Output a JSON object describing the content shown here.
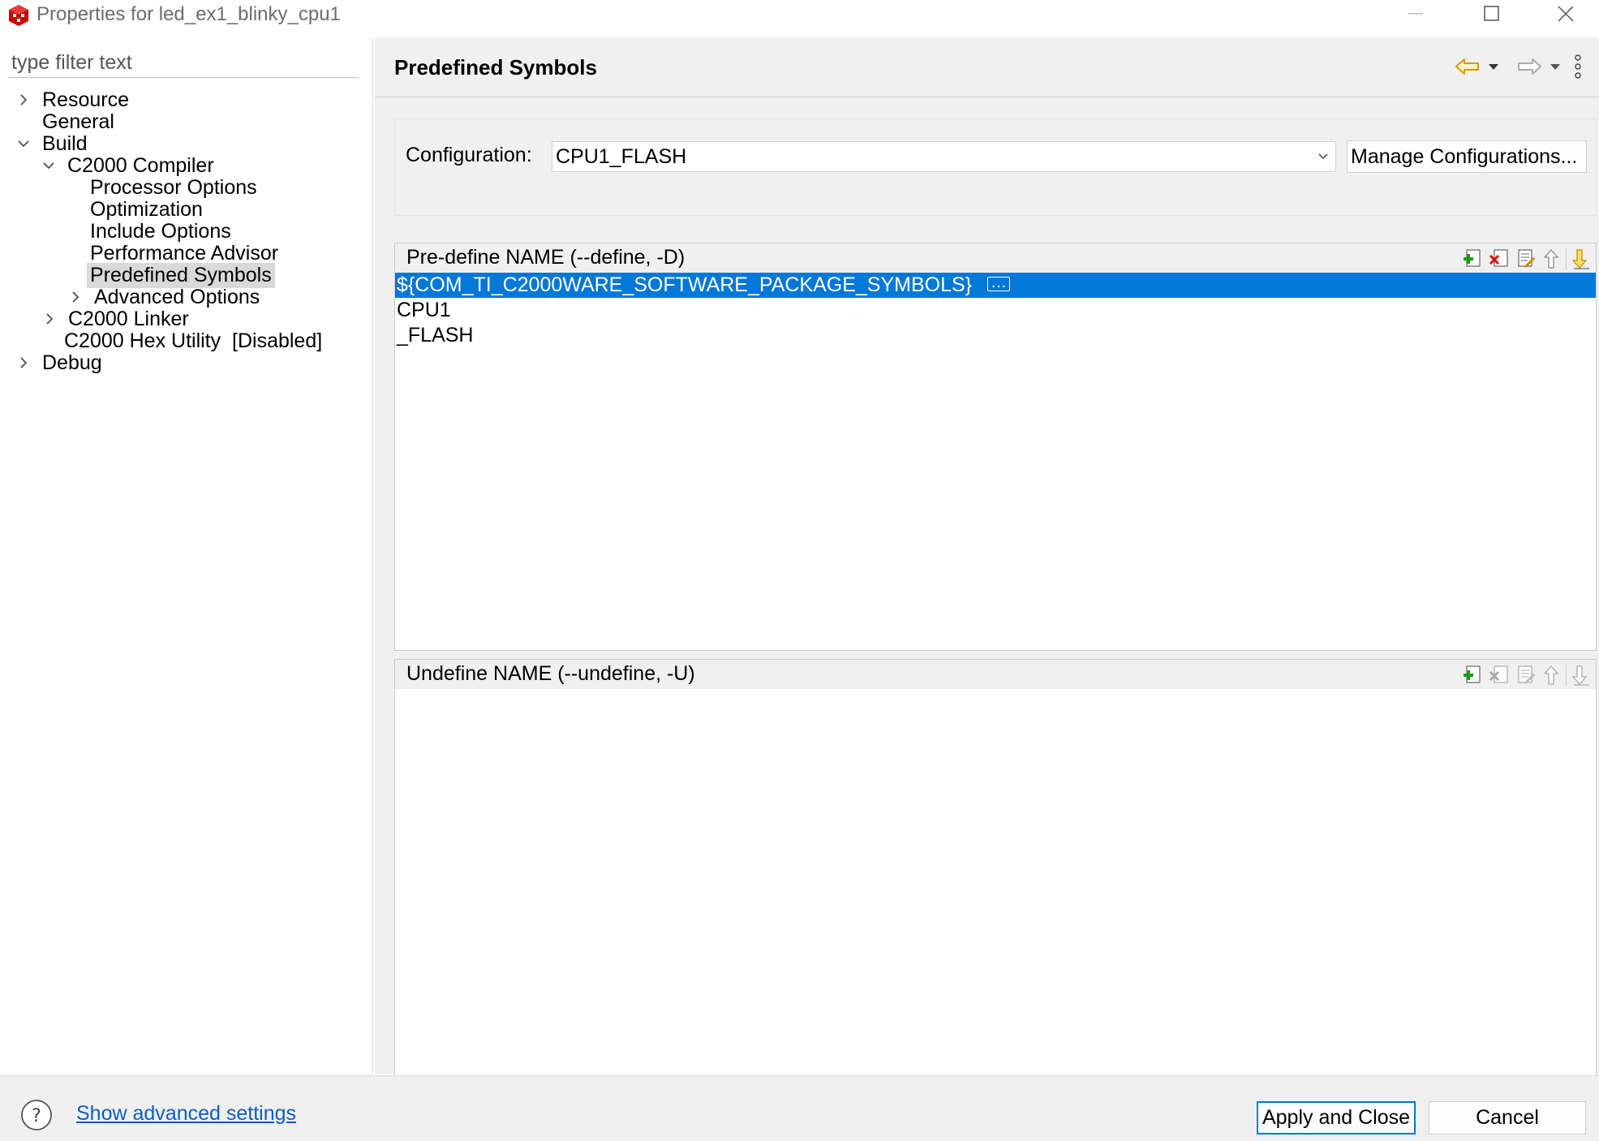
{
  "window": {
    "title": "Properties for led_ex1_blinky_cpu1",
    "app_icon": "ti-cube-icon",
    "controls": [
      "minimize-icon",
      "maximize-icon",
      "close-icon"
    ]
  },
  "sidebar": {
    "filter_placeholder": "type filter text",
    "tree": [
      {
        "label": "Resource",
        "expander": "collapsed"
      },
      {
        "label": "General",
        "expander": "none"
      },
      {
        "label": "Build",
        "expander": "expanded"
      },
      {
        "label": "C2000 Compiler",
        "expander": "expanded"
      },
      {
        "label": "Processor Options",
        "expander": "none"
      },
      {
        "label": "Optimization",
        "expander": "none"
      },
      {
        "label": "Include Options",
        "expander": "none"
      },
      {
        "label": "Performance Advisor",
        "expander": "none"
      },
      {
        "label": "Predefined Symbols",
        "expander": "none",
        "selected": true
      },
      {
        "label": "Advanced Options",
        "expander": "collapsed"
      },
      {
        "label": "C2000 Linker",
        "expander": "collapsed"
      },
      {
        "label": "C2000 Hex Utility  [Disabled]",
        "expander": "none"
      },
      {
        "label": "Debug",
        "expander": "collapsed"
      }
    ]
  },
  "main": {
    "title": "Predefined Symbols",
    "nav_icons": [
      "back-arrow-icon",
      "back-dropdown-icon",
      "forward-arrow-icon",
      "forward-dropdown-icon",
      "view-menu-icon"
    ],
    "configuration": {
      "label": "Configuration:",
      "value": "CPU1_FLASH",
      "manage_button": "Manage Configurations..."
    },
    "predefine": {
      "header": "Pre-define NAME (--define, -D)",
      "items": [
        "${COM_TI_C2000WARE_SOFTWARE_PACKAGE_SYMBOLS}",
        "CPU1",
        "_FLASH"
      ],
      "selected_index": 0
    },
    "undefine": {
      "header": "Undefine NAME (--undefine, -U)",
      "items": []
    },
    "list_tool_icons": [
      "add-icon",
      "delete-icon",
      "edit-icon",
      "move-up-icon",
      "move-down-icon"
    ]
  },
  "footer": {
    "help_icon": "help-icon",
    "advanced_link": "Show advanced settings",
    "apply_button": "Apply and Close",
    "cancel_button": "Cancel"
  },
  "colors": {
    "selection": "#0078d7",
    "link": "#0a5fc2",
    "app_icon": "#cc0000",
    "nav_arrow": "#e6a100"
  }
}
